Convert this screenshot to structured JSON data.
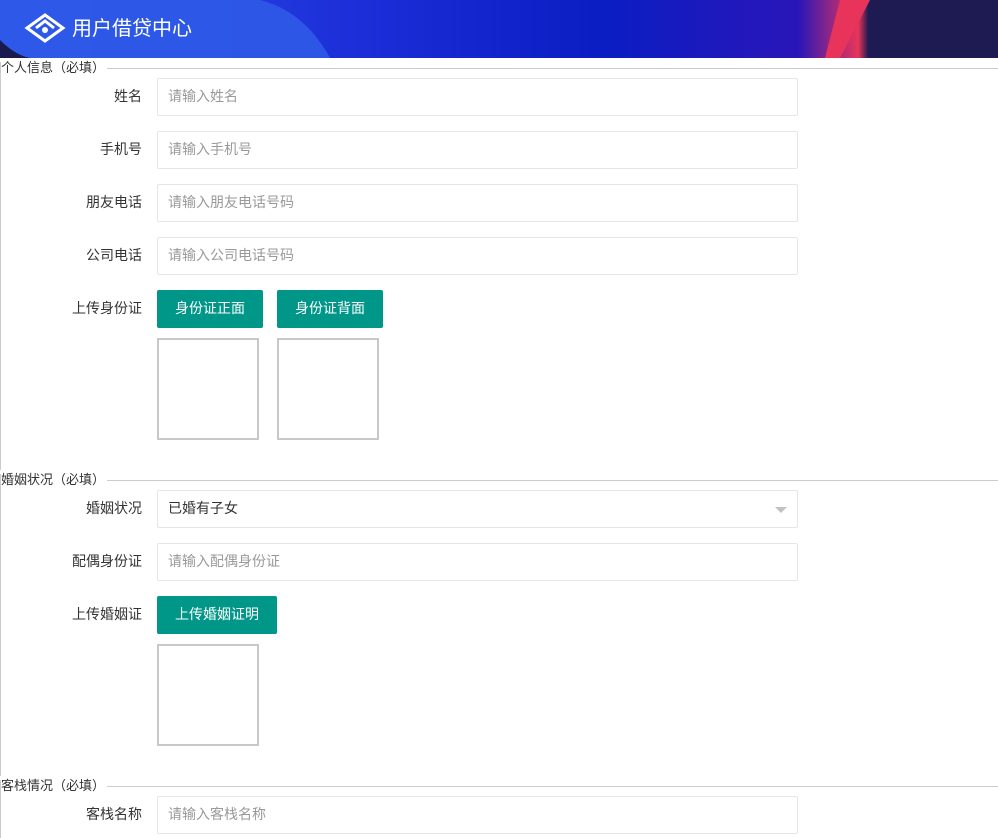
{
  "header": {
    "title": "用户借贷中心",
    "logo_icon": "diamond-logo-icon",
    "gradient": [
      "#1a1a4e",
      "#2a3fe0",
      "#0a22c8",
      "#e83a6a"
    ]
  },
  "sections": {
    "personal": {
      "legend": "个人信息（必填）",
      "name_label": "姓名",
      "name_placeholder": "请输入姓名",
      "phone_label": "手机号",
      "phone_placeholder": "请输入手机号",
      "friend_phone_label": "朋友电话",
      "friend_phone_placeholder": "请输入朋友电话号码",
      "company_phone_label": "公司电话",
      "company_phone_placeholder": "请输入公司电话号码",
      "upload_id_label": "上传身份证",
      "id_front_button": "身份证正面",
      "id_back_button": "身份证背面"
    },
    "marriage": {
      "legend": "婚姻状况（必填）",
      "status_label": "婚姻状况",
      "status_value": "已婚有子女",
      "spouse_id_label": "配偶身份证",
      "spouse_id_placeholder": "请输入配偶身份证",
      "upload_cert_label": "上传婚姻证",
      "upload_cert_button": "上传婚姻证明"
    },
    "inn": {
      "legend": "客栈情况（必填）",
      "name_label": "客栈名称",
      "name_placeholder": "请输入客栈名称"
    }
  },
  "colors": {
    "primary_button": "#009688",
    "border": "#e6e6e6",
    "placeholder": "#999999"
  }
}
